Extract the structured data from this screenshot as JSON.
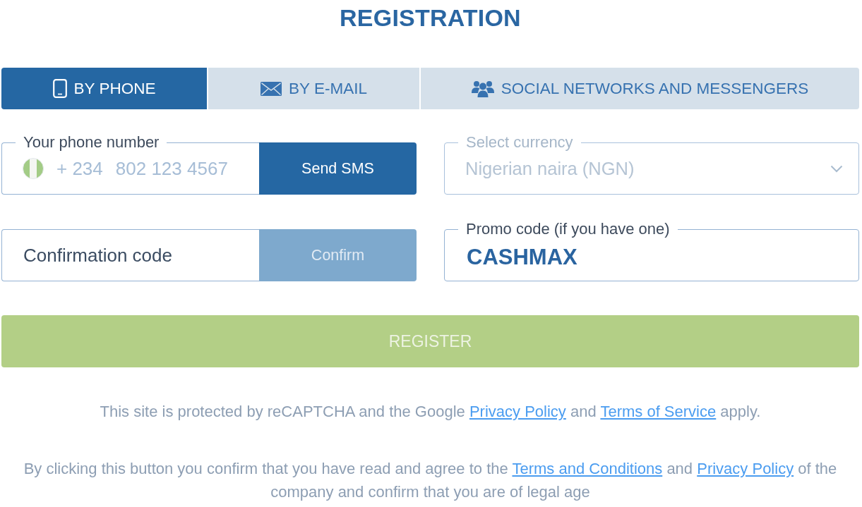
{
  "title": "REGISTRATION",
  "tabs": [
    {
      "kind": "phone",
      "label": "BY PHONE",
      "selected": true
    },
    {
      "kind": "email",
      "label": "BY E-MAIL",
      "selected": false
    },
    {
      "kind": "social",
      "label": "SOCIAL NETWORKS AND MESSENGERS",
      "selected": false
    }
  ],
  "phone_field": {
    "label": "Your phone number",
    "country_code": "+ 234",
    "placeholder": "802 123 4567",
    "button": {
      "label": "Send SMS",
      "disabled": false
    }
  },
  "currency_field": {
    "label": "Select currency",
    "value": "Nigerian naira (NGN)",
    "disabled": true
  },
  "confirmation_field": {
    "placeholder": "Confirmation code",
    "button": {
      "label": "Confirm",
      "disabled": true
    }
  },
  "promo_field": {
    "label": "Promo code (if you have one)",
    "value": "CASHMAX"
  },
  "register_button": {
    "label": "REGISTER",
    "disabled": true
  },
  "notices": [
    {
      "parts": [
        {
          "kind": "text",
          "text": "This site is protected by reCAPTCHA and the Google"
        },
        {
          "kind": "link",
          "text": "Privacy Policy"
        },
        {
          "kind": "text",
          "text": "and"
        },
        {
          "kind": "link",
          "text": "Terms of Service"
        },
        {
          "kind": "text",
          "text": "apply."
        }
      ]
    },
    {
      "parts": [
        {
          "kind": "text",
          "text": "By clicking this button you confirm that you have read and agree to the"
        },
        {
          "kind": "link",
          "text": "Terms and Conditions"
        },
        {
          "kind": "text",
          "text": "and"
        },
        {
          "kind": "link",
          "text": "Privacy Policy"
        },
        {
          "kind": "text",
          "text": "of the company and confirm that you are of legal age"
        }
      ]
    }
  ]
}
